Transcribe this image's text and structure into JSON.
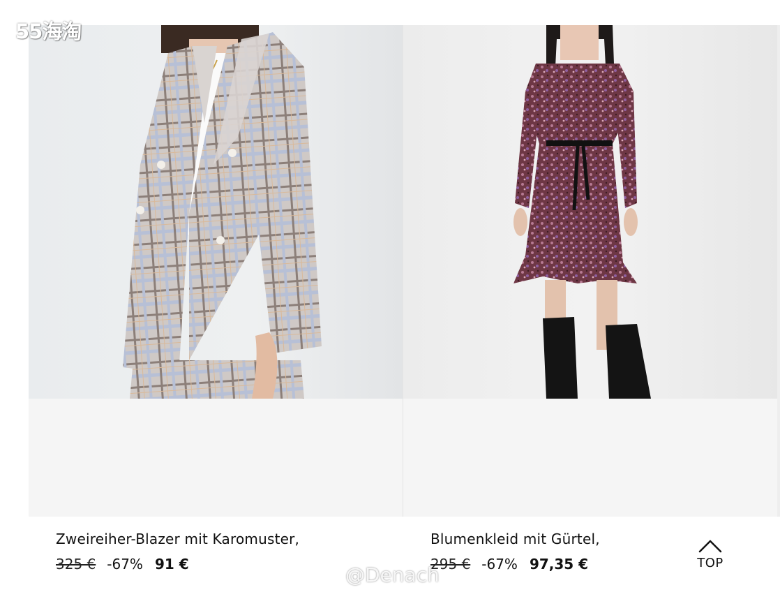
{
  "watermarks": {
    "top_left": "55海淘",
    "bottom": "@Denach"
  },
  "products": [
    {
      "title": "Zweireiher-Blazer mit Karomuster,",
      "old_price": "325 €",
      "discount": "-67%",
      "new_price": "91 €",
      "image_icon": "blazer-photo"
    },
    {
      "title": "Blumenkleid mit Gürtel,",
      "old_price": "295 €",
      "discount": "-67%",
      "new_price": "97,35 €",
      "image_icon": "dress-photo"
    }
  ],
  "top_button": {
    "label": "TOP",
    "icon": "chevron-up-icon"
  },
  "colors": {
    "text": "#111111",
    "card_bg": "#f5f5f5",
    "background": "#ffffff"
  }
}
